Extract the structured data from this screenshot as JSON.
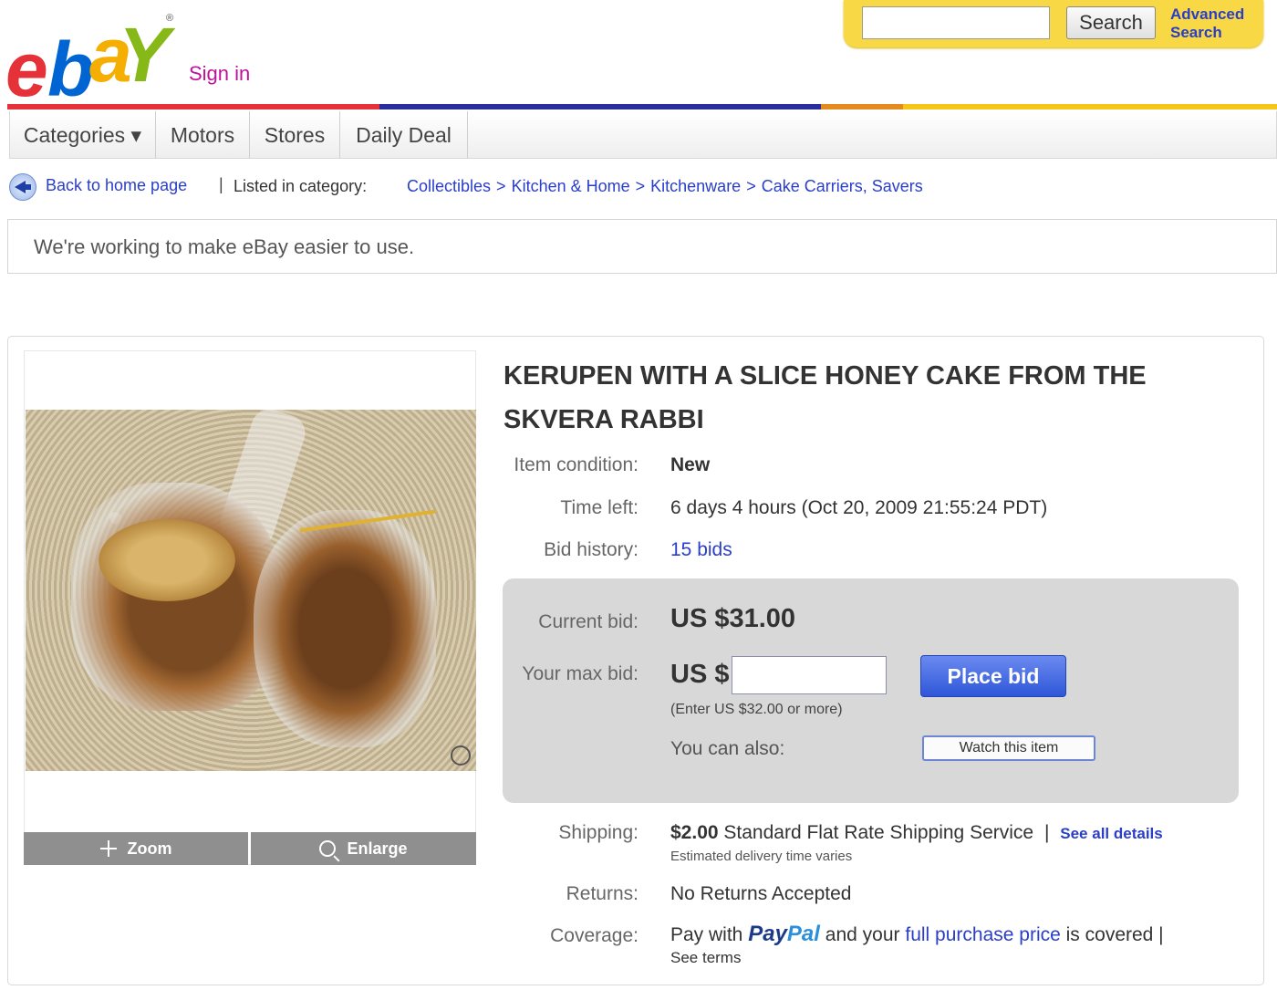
{
  "header": {
    "logo_text": "ebay",
    "registered_mark": "®",
    "sign_in": "Sign in",
    "search": {
      "value": "",
      "button_label": "Search",
      "advanced_label_line1": "Advanced",
      "advanced_label_line2": "Search"
    }
  },
  "nav": {
    "tabs": [
      "Categories ▾",
      "Motors",
      "Stores",
      "Daily Deal"
    ]
  },
  "breadcrumb": {
    "back_label": "Back to home page",
    "separator": "|",
    "listed_label": "Listed in category:",
    "categories": [
      "Collectibles",
      "Kitchen & Home",
      "Kitchenware",
      "Cake Carriers, Savers"
    ],
    "arrow": ">"
  },
  "notice": "We're working to make eBay easier to use.",
  "photo": {
    "zoom_label": "Zoom",
    "enlarge_label": "Enlarge"
  },
  "item": {
    "title": "KERUPEN WITH A SLICE HONEY CAKE FROM THE SKVERA RABBI",
    "condition_label": "Item condition:",
    "condition": "New",
    "time_left_label": "Time left:",
    "time_left": "6 days 4 hours (Oct 20, 2009  21:55:24 PDT)",
    "bid_history_label": "Bid history:",
    "bid_history": "15 bids"
  },
  "bidding": {
    "current_bid_label": "Current bid:",
    "current_bid": "US $31.00",
    "max_bid_label": "Your max bid:",
    "currency_prefix": "US $",
    "max_bid_value": "",
    "place_bid_label": "Place bid",
    "hint": "(Enter US $32.00 or more)",
    "also_label": "You can also:",
    "watch_label": "Watch this item"
  },
  "shipping": {
    "label": "Shipping:",
    "price": "$2.00",
    "service": "Standard Flat Rate Shipping Service",
    "separator": "|",
    "details_link": "See all details",
    "estimate": "Estimated delivery time varies"
  },
  "returns": {
    "label": "Returns:",
    "value": "No Returns Accepted"
  },
  "coverage": {
    "label": "Coverage:",
    "text_before": "Pay with",
    "paypal_pay": "Pay",
    "paypal_pal": "Pal",
    "text_mid": "and your",
    "link": "full purchase price",
    "text_after": "is covered |",
    "see_terms": "See terms"
  },
  "colors": {
    "ebay_red": "#e53238",
    "ebay_blue": "#0064d2",
    "ebay_yellow": "#f5af02",
    "ebay_green": "#86b817",
    "link": "#2a3ec7",
    "signin": "#c0119d"
  }
}
